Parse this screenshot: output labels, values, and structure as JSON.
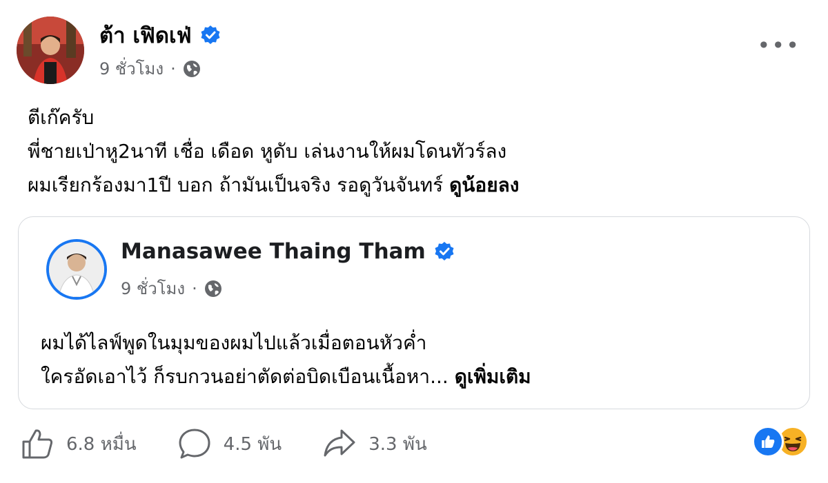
{
  "post": {
    "author_name": "ต้า เฟิดเฟ่",
    "time": "9 ชั่วโมง",
    "separator": "·",
    "privacy_icon": "globe-icon",
    "more_icon": "more-options-icon",
    "text_lines": [
      "ตีเก๊ครับ",
      "พี่ชายเป่าหู2นาที เชื่อ เดือด หูดับ เล่นงานให้ผมโดนทัวร์ลง",
      "ผมเรียกร้องมา1ปี บอก ถ้ามันเป็นจริง รอดูวันจันทร์ "
    ],
    "text_emphasis": "ดูน้อยลง"
  },
  "shared_post": {
    "author_name": "Manasawee Thaing Tham",
    "time": "9 ชั่วโมง",
    "separator": "·",
    "text_lines": [
      "ผมได้ไลฟ์พูดในมุมของผมไปแล้วเมื่อตอนหัวค่ำ",
      "ใครอัดเอาไว้ ก็รบกวนอย่าตัดต่อบิดเบือนเนื้อหา... "
    ],
    "see_more": "ดูเพิ่มเติม"
  },
  "stats": {
    "likes": "6.8 หมื่น",
    "comments": "4.5 พัน",
    "shares": "3.3 พัน"
  },
  "reactions": [
    "like",
    "haha"
  ],
  "colors": {
    "verified_blue": "#1877f2",
    "secondary_text": "#65676b",
    "primary_text": "#050505",
    "haha_yellow": "#f7b125"
  }
}
